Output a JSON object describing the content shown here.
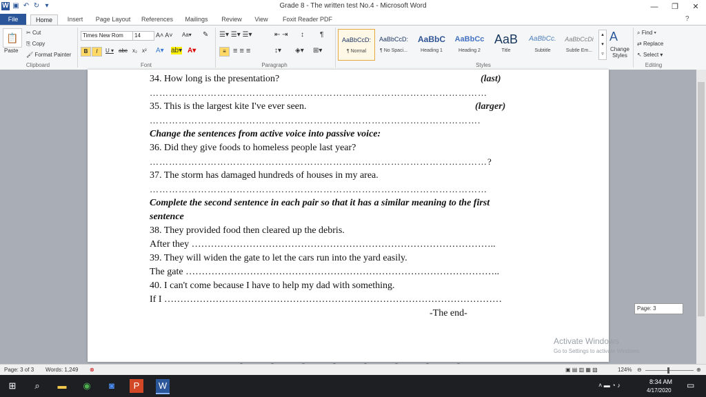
{
  "window": {
    "title": "Grade 8 - The written test No.4 - Microsoft Word"
  },
  "tabs": [
    "File",
    "Home",
    "Insert",
    "Page Layout",
    "References",
    "Mailings",
    "Review",
    "View",
    "Foxit Reader PDF"
  ],
  "ribbon": {
    "clipboard": {
      "label": "Clipboard",
      "paste": "Paste",
      "cut": "Cut",
      "copy": "Copy",
      "format_painter": "Format Painter"
    },
    "font": {
      "label": "Font",
      "font_name": "Times New Rom",
      "font_size": "14"
    },
    "paragraph": {
      "label": "Paragraph"
    },
    "styles": {
      "label": "Styles",
      "items": [
        {
          "sample": "AaBbCcD:",
          "name": "¶ Normal"
        },
        {
          "sample": "AaBbCcD:",
          "name": "¶ No Spaci..."
        },
        {
          "sample": "AaBbC",
          "name": "Heading 1"
        },
        {
          "sample": "AaBbCc",
          "name": "Heading 2"
        },
        {
          "sample": "AaB",
          "name": "Title"
        },
        {
          "sample": "AaBbCc.",
          "name": "Subtitle"
        },
        {
          "sample": "AaBbCcDi",
          "name": "Subtle Em..."
        }
      ],
      "change_styles": "Change Styles"
    },
    "editing": {
      "label": "Editing",
      "find": "Find",
      "replace": "Replace",
      "select": "Select"
    }
  },
  "document": {
    "lines": [
      {
        "text": "34. How long is the presentation?",
        "hint": "(last)"
      },
      {
        "dots": "……………………………………………………………………………………………"
      },
      {
        "text": "35. This is the largest kite I've ever seen.",
        "hint": "(larger)"
      },
      {
        "dots": "…………………………………………………………………………………………."
      },
      {
        "text": "Change the sentences from active voice into passive voice:"
      },
      {
        "text": "36. Did they give foods to homeless people last year?"
      },
      {
        "dots": "……………………………………………………………………………………………?"
      },
      {
        "text": "37. The storm has damaged hundreds of houses in my area."
      },
      {
        "dots": "……………………………………………………………………………………………"
      },
      {
        "text": "Complete the second sentence in each pair so that it has a similar meaning to the first"
      },
      {
        "text": "sentence"
      },
      {
        "text": "38. They provided food then cleared up the debris."
      },
      {
        "text": "After they ………………………………………………………………………………….."
      },
      {
        "text": "39. They will widen the gate to let the cars run into the yard easily."
      },
      {
        "text": "The gate …………………………………………………………………………………….."
      },
      {
        "text": "40. I can't come because I have to help my dad with something."
      },
      {
        "text": "If I ……………………………………………………………………………………………"
      },
      {
        "text": "-The end-"
      }
    ]
  },
  "page_tooltip": "Page: 3",
  "watermark": {
    "line1": "Activate Windows",
    "line2": "Go to Settings to activate Windows."
  },
  "status": {
    "page": "Page: 3 of 3",
    "words": "Words: 1,249",
    "zoom": "124%"
  },
  "taskbar": {
    "time": "8:34 AM",
    "date": "4/17/2020"
  }
}
